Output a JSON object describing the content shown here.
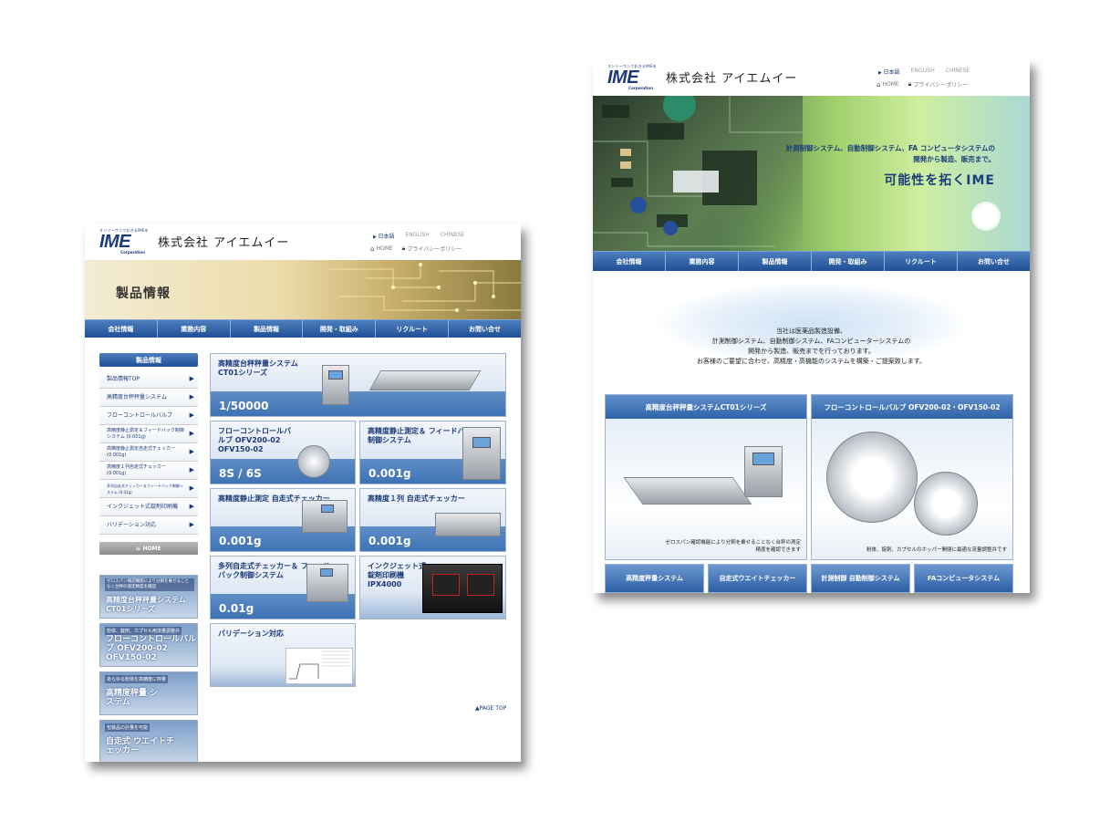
{
  "left_page": {
    "logo": {
      "tagline": "オンリーワンでおきるIMEを",
      "mark": "IME",
      "corp": "Corporation"
    },
    "company": "株式会社 アイエムイー",
    "languages": [
      "日本語",
      "ENGLISH",
      "CHINESE"
    ],
    "sublinks": {
      "home": "HOME",
      "privacy": "プライバシーポリシー"
    },
    "banner_title": "製品情報",
    "nav": [
      "会社情報",
      "業務内容",
      "製品情報",
      "開発・取組み",
      "リクルート",
      "お問い合せ"
    ],
    "sidebar": {
      "heading": "製品情報",
      "items": [
        "製品情報TOP",
        "高精度台秤秤量システム",
        "フローコントロールバルブ",
        "高精度静止測定＆フィードバック制御システム (0.001g)",
        "高精度静止測定自走式チェッカー (0.001g)",
        "高精度１列自走式チェッカー (0.001g)",
        "多列自走式チェッカー＆フィードバック制御システム (0.01g)",
        "インクジェット式錠剤印刷機",
        "バリデーション対応"
      ],
      "home": "HOME"
    },
    "promos": [
      {
        "small": "ゼロスパン確認機能により分銅を乗せることなく台秤の測定精度を確認",
        "big": "高精度台秤秤量システム CT01シリーズ"
      },
      {
        "small": "粉体、錠剤、カプセル用流量調整弁",
        "big": "フローコントロールバルブ OFV200-02 OFV150-02"
      },
      {
        "small": "あらゆる粉体を高精度に秤量",
        "big": "高精度秤量 システム"
      },
      {
        "small": "包装品の計量を可能",
        "big": "自走式 ウエイトチェッカー"
      }
    ],
    "products": [
      {
        "name": "高精度台秤秤量システム CT01シリーズ",
        "spec": "1/50000"
      },
      {
        "name": "フローコントロールバルブ OFV200-02 OFV150-02",
        "spec": "8S / 6S"
      },
      {
        "name": "高精度静止測定＆ フィードバック制御システム",
        "spec": "0.001g"
      },
      {
        "name": "高精度静止測定 自走式チェッカー",
        "spec": "0.001g"
      },
      {
        "name": "高精度１列 自走式チェッカー",
        "spec": "0.001g"
      },
      {
        "name": "多列自走式チェッカー＆ フィードバック制御システム",
        "spec": "0.01g"
      },
      {
        "name": "インクジェット式 錠剤印刷機 IPX4000",
        "spec": ""
      },
      {
        "name": "バリデーション対応",
        "spec": ""
      }
    ],
    "page_top": "▲PAGE TOP"
  },
  "right_page": {
    "logo": {
      "tagline": "オンリーワンでおきるIMEを",
      "mark": "IME",
      "corp": "Corporation"
    },
    "company": "株式会社 アイエムイー",
    "languages": [
      "日本語",
      "ENGLISH",
      "CHINESE"
    ],
    "sublinks": {
      "home": "HOME",
      "privacy": "プライバシーポリシー"
    },
    "hero": {
      "line1": "計測制御システム、自動制御システム、FA コンピュータシステムの",
      "line2": "開発から製造、販売まで。",
      "headline": "可能性を拓くIME"
    },
    "nav": [
      "会社情報",
      "業務内容",
      "製品情報",
      "開発・取組み",
      "リクルート",
      "お問い合せ"
    ],
    "intro": [
      "当社は医薬品製造設備、",
      "計測制御システム、自動制御システム、FAコンピューターシステムの",
      "開発から製造、販売までを行っております。",
      "お客様のご要望に合わせ、高精度・高機能のシステムを構築・ご提案致します。"
    ],
    "features": [
      {
        "title": "高精度台秤秤量システムCT01シリーズ",
        "caption": "ゼロスパン確認機能により分銅を乗せることなく台秤の測定精度を確認できます"
      },
      {
        "title": "フローコントロールバルブ OFV200-02・OFV150-02",
        "caption": "粉体、錠剤、カプセルのホッパー開閉に最適な流量調整弁です"
      }
    ],
    "tiles": [
      "高精度秤量システム",
      "自走式ウエイトチェッカー",
      "計測制御 自動制御システム",
      "FAコンピュータシステム"
    ]
  }
}
